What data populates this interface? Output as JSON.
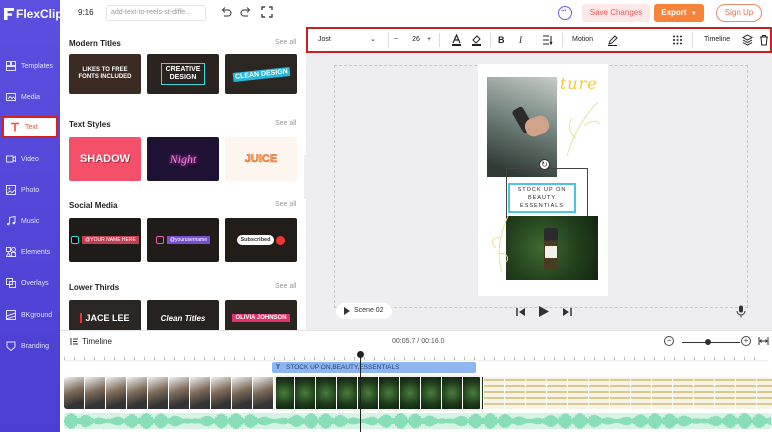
{
  "app": {
    "logo_text": "FlexClip"
  },
  "nav": [
    {
      "label": "Templates",
      "icon": "templates-icon"
    },
    {
      "label": "Media",
      "icon": "media-icon"
    },
    {
      "label": "Text",
      "icon": "text-icon",
      "active": true
    },
    {
      "label": "Video",
      "icon": "video-icon"
    },
    {
      "label": "Photo",
      "icon": "photo-icon"
    },
    {
      "label": "Music",
      "icon": "music-icon"
    },
    {
      "label": "Elements",
      "icon": "elements-icon"
    },
    {
      "label": "Overlays",
      "icon": "overlays-icon"
    },
    {
      "label": "BKground",
      "icon": "background-icon"
    },
    {
      "label": "Branding",
      "icon": "branding-icon"
    }
  ],
  "topbar": {
    "ratio": "9:16",
    "filename": "add-text-to-reels-st-diffe...",
    "save_label": "Save Changes",
    "export_label": "Export",
    "signup_label": "Sign Up"
  },
  "panel": {
    "see_all": "See all",
    "sections": [
      {
        "title": "Modern Titles",
        "thumbs": [
          "LIKES TO FREE FONTS INCLUDED",
          "CREATIVE DESIGN",
          "CLEAN DESIGN"
        ]
      },
      {
        "title": "Text Styles",
        "thumbs": [
          "SHADOW",
          "Night",
          "JUICE"
        ]
      },
      {
        "title": "Social Media",
        "thumbs": [
          "@YOUR NAME HERE",
          "@yourusername",
          "Subscribed"
        ]
      },
      {
        "title": "Lower Thirds",
        "thumbs": [
          "JACE LEE",
          "Clean Titles",
          "OLIVIA JOHNSON"
        ]
      }
    ]
  },
  "toolbar": {
    "font": "Jost",
    "font_size": "26",
    "minus": "−",
    "plus": "+",
    "bold": "B",
    "italic": "I",
    "motion_label": "Motion",
    "timeline_label": "Timeline"
  },
  "canvas": {
    "title_text": "nature",
    "caption_text": "STOCK UP ON BEAUTY ESSENTIALS",
    "scene_label": "Scene 02"
  },
  "timeline": {
    "label": "Timeline",
    "time": "00:05.7 / 00:16.0",
    "text_clip_label": "STOCK UP ON,BEAUTY,ESSENTIALS"
  },
  "colors": {
    "nav_bg": "#5b4fe0",
    "accent_red": "#cc1f1f",
    "export_orange": "#f7823a",
    "text_clip_blue": "#8fb5f0",
    "audio_green": "#37c88a"
  }
}
